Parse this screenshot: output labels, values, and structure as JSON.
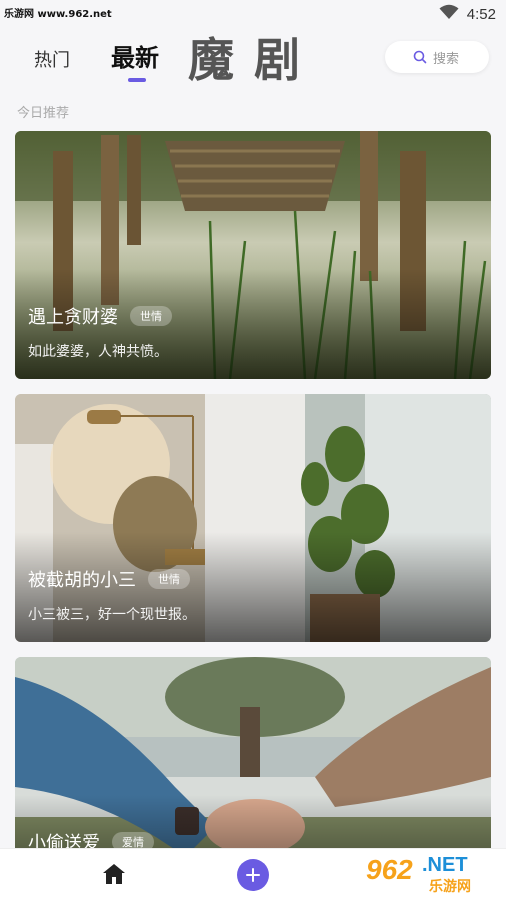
{
  "status_bar": {
    "watermark": "乐游网 www.962.net",
    "time": "4:52"
  },
  "header": {
    "tab_hot": "热门",
    "tab_new": "最新",
    "brand": "魔剧",
    "search_placeholder": "搜索"
  },
  "section": {
    "label": "今日推荐"
  },
  "cards": [
    {
      "title": "遇上贪财婆",
      "tag": "世情",
      "desc": "如此婆婆，人神共愤。"
    },
    {
      "title": "被截胡的小三",
      "tag": "世情",
      "desc": "小三被三，好一个现世报。"
    },
    {
      "title": "小偷送爱",
      "tag": "爱情",
      "desc": ""
    }
  ],
  "watermark_bottom": {
    "number": "962",
    "net": ".NET",
    "sub": "乐游网"
  },
  "colors": {
    "accent": "#6a5be2",
    "background": "#f6f6f8"
  },
  "icons": {
    "signal": "wifi-signal-icon",
    "search": "search-icon",
    "home": "home-icon",
    "add": "plus-icon"
  }
}
